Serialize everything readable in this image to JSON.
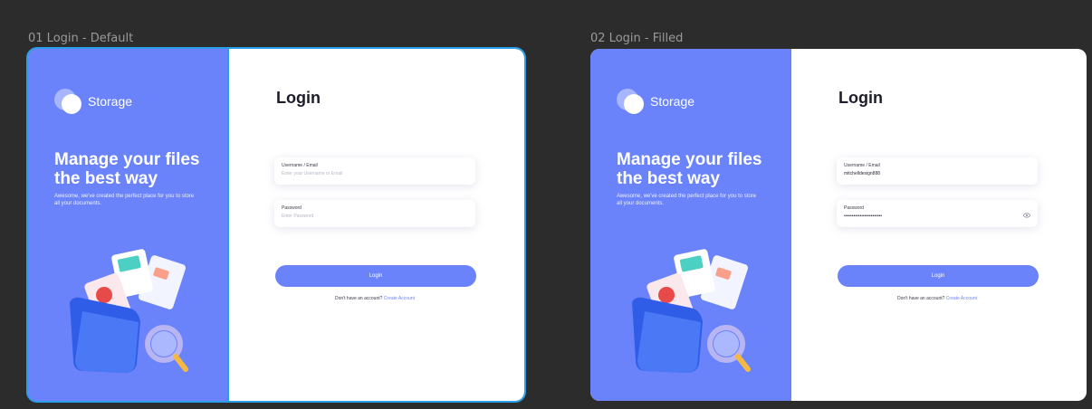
{
  "frames": [
    {
      "label": "01 Login - Default",
      "brand": "Storage",
      "headline": "Manage your files the best way",
      "subtext": "Awesome, we've created the perfect place for you to store all your documents.",
      "title": "Login",
      "username": {
        "label": "Username / Email",
        "value": "Enter your Username or Email"
      },
      "password": {
        "label": "Password",
        "value": "Enter Password"
      },
      "button": "Login",
      "signup_text": "Don't have an account?",
      "signup_link": "Create Account"
    },
    {
      "label": "02 Login - Filled",
      "brand": "Storage",
      "headline": "Manage your files the best way",
      "subtext": "Awesome, we've created the perfect place for you to store all your documents.",
      "title": "Login",
      "username": {
        "label": "Username / Email",
        "value": "mitchelldesign888"
      },
      "password": {
        "label": "Password",
        "value": "••••••••••••••••••••••••"
      },
      "button": "Login",
      "signup_text": "Don't have an account?",
      "signup_link": "Create Account"
    }
  ],
  "colors": {
    "canvas": "#2c2c2c",
    "accent": "#6a83fa",
    "selection": "#2a9ee8"
  },
  "icons": [
    "storage-logo-icon",
    "eye-icon",
    "folder-illustration"
  ]
}
